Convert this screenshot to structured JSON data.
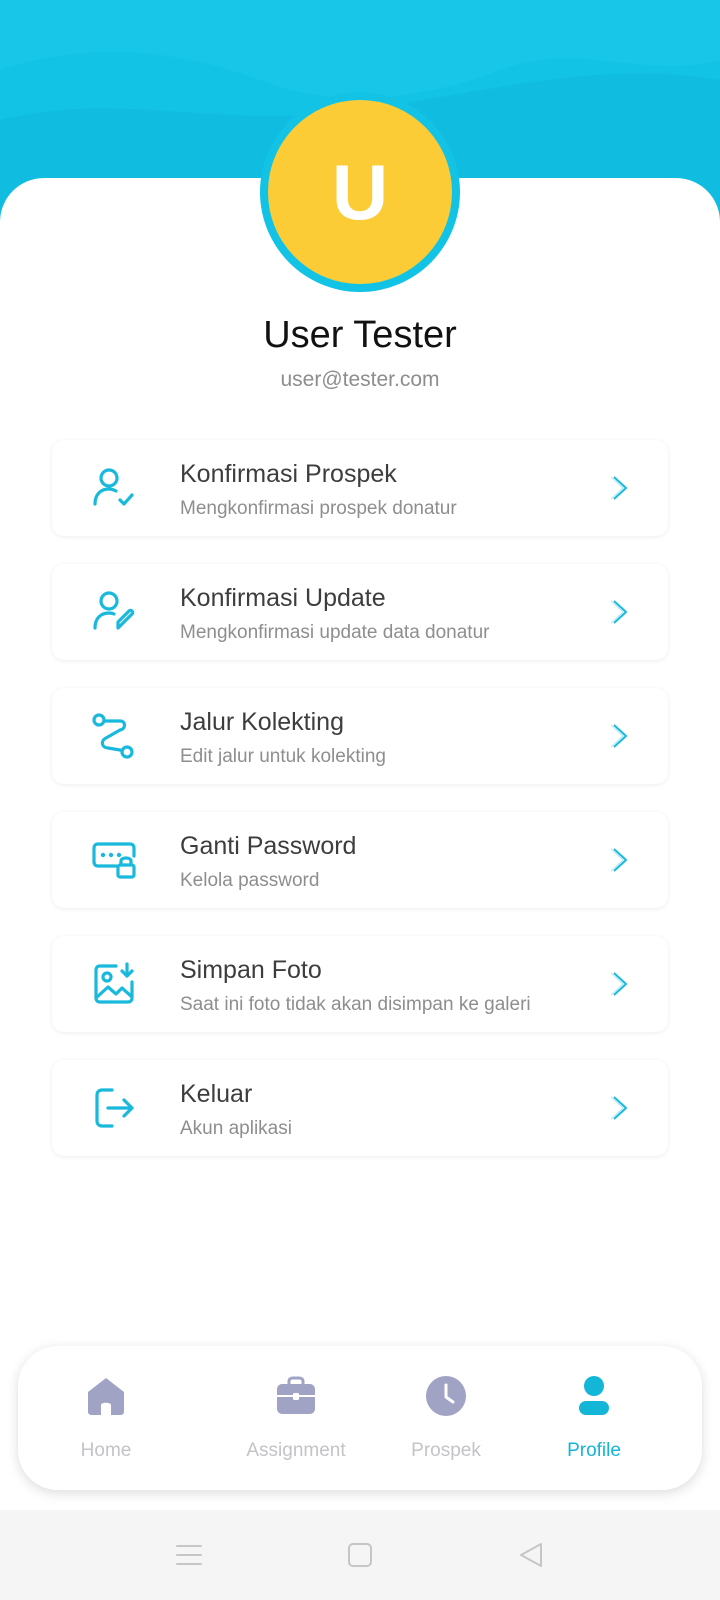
{
  "colors": {
    "primary": "#12c3e6",
    "avatar_bg": "#fccc36",
    "icon": "#18b9dc",
    "nav_inactive": "#a0a3c4",
    "nav_active": "#14b6d8"
  },
  "profile": {
    "initial": "U",
    "name": "User Tester",
    "email": "user@tester.com"
  },
  "menu": [
    {
      "icon": "user-check-icon",
      "title": "Konfirmasi Prospek",
      "subtitle": "Mengkonfirmasi prospek donatur"
    },
    {
      "icon": "user-edit-icon",
      "title": "Konfirmasi Update",
      "subtitle": "Mengkonfirmasi update data donatur"
    },
    {
      "icon": "route-icon",
      "title": "Jalur Kolekting",
      "subtitle": "Edit jalur untuk kolekting"
    },
    {
      "icon": "password-lock-icon",
      "title": "Ganti Password",
      "subtitle": "Kelola password"
    },
    {
      "icon": "image-download-icon",
      "title": "Simpan Foto",
      "subtitle": "Saat ini foto tidak akan disimpan ke galeri"
    },
    {
      "icon": "logout-icon",
      "title": "Keluar",
      "subtitle": "Akun aplikasi"
    }
  ],
  "nav": [
    {
      "icon": "home-icon",
      "label": "Home",
      "active": false
    },
    {
      "icon": "briefcase-icon",
      "label": "Assignment",
      "active": false
    },
    {
      "icon": "clock-icon",
      "label": "Prospek",
      "active": false
    },
    {
      "icon": "person-icon",
      "label": "Profile",
      "active": true
    }
  ],
  "system_nav": [
    "menu-icon",
    "square-icon",
    "back-triangle-icon"
  ]
}
